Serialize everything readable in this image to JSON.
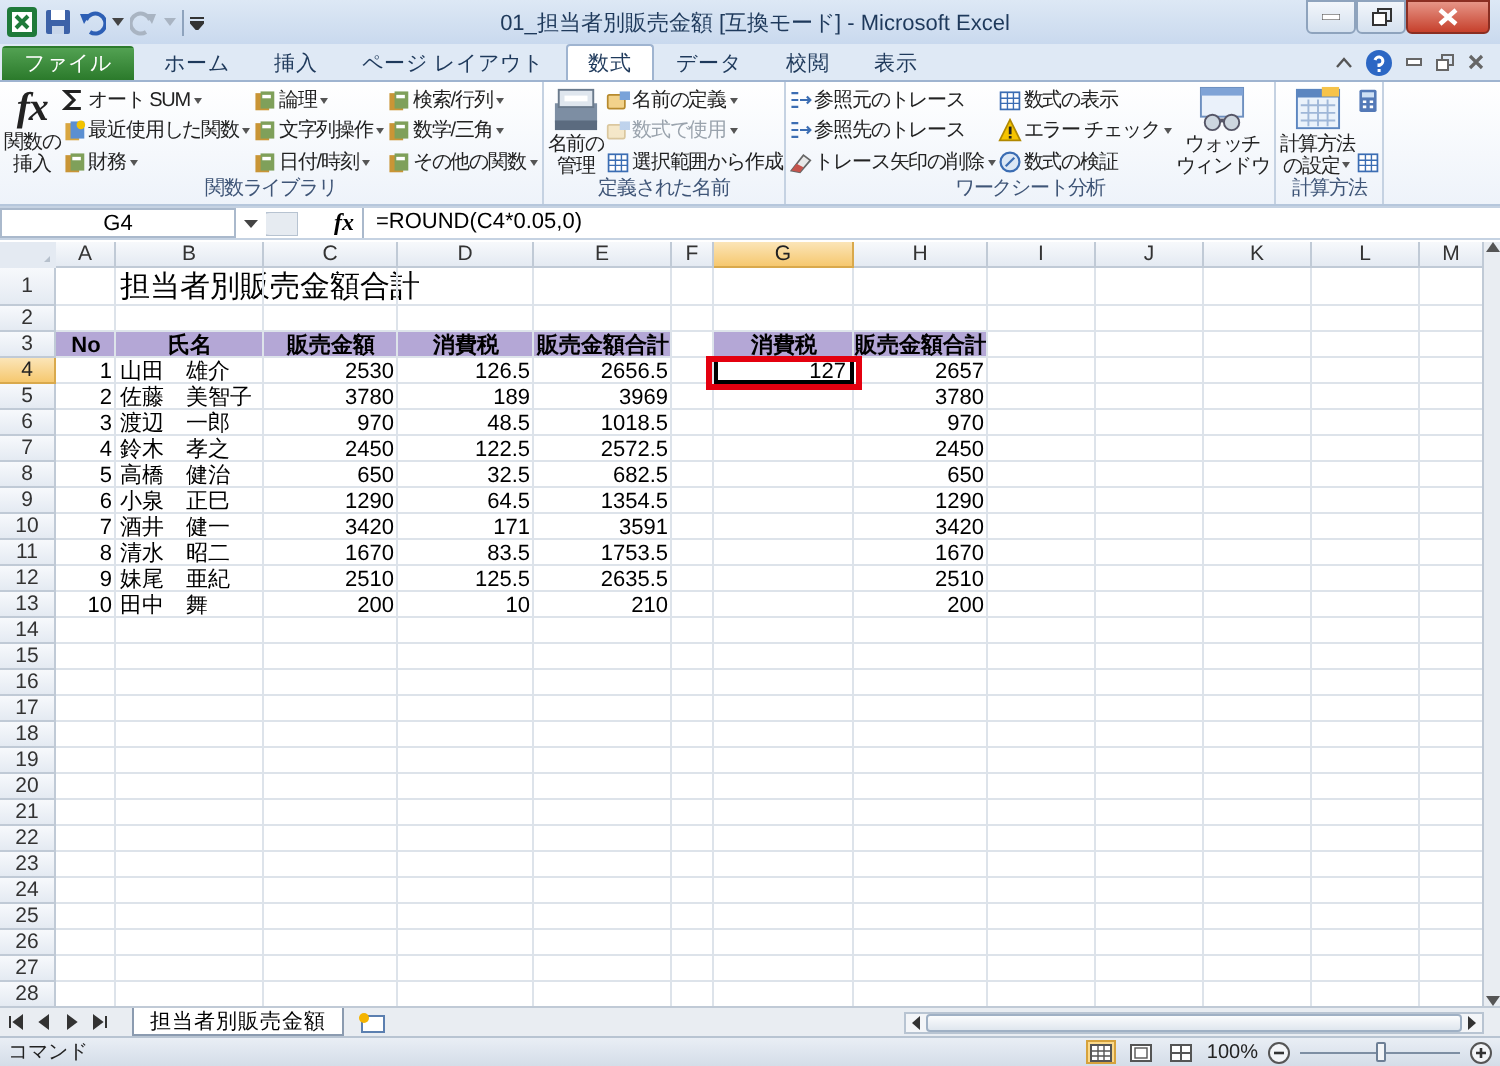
{
  "window": {
    "title": "01_担当者別販売金額 [互換モード] - Microsoft Excel",
    "quick_access": [
      {
        "kind": "save",
        "disabled": false
      },
      {
        "kind": "undo",
        "disabled": false
      },
      {
        "kind": "redo",
        "disabled": true
      }
    ]
  },
  "tabs": [
    {
      "label": "ファイル",
      "kind": "file",
      "selected": false
    },
    {
      "label": "ホーム",
      "kind": "tab",
      "selected": false
    },
    {
      "label": "挿入",
      "kind": "tab",
      "selected": false
    },
    {
      "label": "ページ レイアウト",
      "kind": "tab",
      "selected": false
    },
    {
      "label": "数式",
      "kind": "tab",
      "selected": true
    },
    {
      "label": "データ",
      "kind": "tab",
      "selected": false
    },
    {
      "label": "校閲",
      "kind": "tab",
      "selected": false
    },
    {
      "label": "表示",
      "kind": "tab",
      "selected": false
    }
  ],
  "ribbon": {
    "groups": [
      {
        "label": "関数ライブラリ",
        "large": [
          {
            "glyph": "fx",
            "lines": [
              "関数の",
              "挿入"
            ],
            "dropdown": false
          }
        ],
        "columns": [
          [
            {
              "label": "オート SUM",
              "dropdown": true,
              "disabled": false
            },
            {
              "label": "最近使用した関数",
              "dropdown": true,
              "disabled": false
            },
            {
              "label": "財務",
              "dropdown": true,
              "disabled": false
            }
          ],
          [
            {
              "label": "論理",
              "dropdown": true,
              "disabled": false
            },
            {
              "label": "文字列操作",
              "dropdown": true,
              "disabled": false
            },
            {
              "label": "日付/時刻",
              "dropdown": true,
              "disabled": false
            }
          ],
          [
            {
              "label": "検索/行列",
              "dropdown": true,
              "disabled": false
            },
            {
              "label": "数学/三角",
              "dropdown": true,
              "disabled": false
            },
            {
              "label": "その他の関数",
              "dropdown": true,
              "disabled": false
            }
          ]
        ]
      },
      {
        "label": "定義された名前",
        "large": [
          {
            "lines": [
              "名前の",
              "管理"
            ],
            "dropdown": false
          }
        ],
        "columns": [
          [
            {
              "label": "名前の定義",
              "dropdown": true,
              "disabled": false
            },
            {
              "label": "数式で使用",
              "dropdown": true,
              "disabled": true
            },
            {
              "label": "選択範囲から作成",
              "dropdown": false,
              "disabled": false
            }
          ]
        ]
      },
      {
        "label": "ワークシート分析",
        "columns": [
          [
            {
              "label": "参照元のトレース",
              "dropdown": false,
              "disabled": false
            },
            {
              "label": "参照先のトレース",
              "dropdown": false,
              "disabled": false
            },
            {
              "label": "トレース矢印の削除",
              "dropdown": true,
              "disabled": false
            }
          ],
          [
            {
              "label": "数式の表示",
              "dropdown": false,
              "disabled": false
            },
            {
              "label": "エラー チェック",
              "dropdown": true,
              "disabled": false
            },
            {
              "label": "数式の検証",
              "dropdown": false,
              "disabled": false
            }
          ]
        ],
        "large_after": [
          {
            "lines": [
              "ウォッチ",
              "ウィンドウ"
            ],
            "dropdown": false
          }
        ]
      },
      {
        "label": "計算方法",
        "large": [
          {
            "lines": [
              "計算方法",
              "の設定"
            ],
            "dropdown": true
          }
        ],
        "columns": [
          [
            {
              "dropdown": false,
              "disabled": false
            },
            {
              "dropdown": false,
              "disabled": false
            }
          ]
        ]
      }
    ]
  },
  "formula_bar": {
    "name_box": "G4",
    "fx": "fx",
    "formula": "=ROUND(C4*0.05,0)"
  },
  "sheet": {
    "columns": [
      {
        "label": "A",
        "selected": false
      },
      {
        "label": "B",
        "selected": false
      },
      {
        "label": "C",
        "selected": false
      },
      {
        "label": "D",
        "selected": false
      },
      {
        "label": "E",
        "selected": false
      },
      {
        "label": "F",
        "selected": false
      },
      {
        "label": "G",
        "selected": true
      },
      {
        "label": "H",
        "selected": false
      },
      {
        "label": "I",
        "selected": false
      },
      {
        "label": "J",
        "selected": false
      },
      {
        "label": "K",
        "selected": false
      },
      {
        "label": "L",
        "selected": false
      },
      {
        "label": "M",
        "selected": false
      }
    ],
    "rows": [
      {
        "number": "1",
        "kind": "title",
        "selected": false,
        "cells": {
          "B": "担当者別販売金額合計"
        }
      },
      {
        "number": "2",
        "kind": "data",
        "selected": false
      },
      {
        "number": "3",
        "kind": "header",
        "selected": false,
        "cells": {
          "A": "No",
          "B": "氏名",
          "C": "販売金額",
          "D": "消費税",
          "E": "販売金額合計",
          "G": "消費税",
          "H": "販売金額合計"
        }
      },
      {
        "number": "4",
        "kind": "data",
        "selected": true,
        "cells": {
          "A": "1",
          "B": "山田　雄介",
          "C": "2530",
          "D": "126.5",
          "E": "2656.5",
          "G": {
            "value": "127",
            "active": true,
            "framed": true
          },
          "H": "2657"
        }
      },
      {
        "number": "5",
        "kind": "data",
        "selected": false,
        "cells": {
          "A": "2",
          "B": "佐藤　美智子",
          "C": "3780",
          "D": "189",
          "E": "3969",
          "H": "3780"
        }
      },
      {
        "number": "6",
        "kind": "data",
        "selected": false,
        "cells": {
          "A": "3",
          "B": "渡辺　一郎",
          "C": "970",
          "D": "48.5",
          "E": "1018.5",
          "H": "970"
        }
      },
      {
        "number": "7",
        "kind": "data",
        "selected": false,
        "cells": {
          "A": "4",
          "B": "鈴木　孝之",
          "C": "2450",
          "D": "122.5",
          "E": "2572.5",
          "H": "2450"
        }
      },
      {
        "number": "8",
        "kind": "data",
        "selected": false,
        "cells": {
          "A": "5",
          "B": "高橋　健治",
          "C": "650",
          "D": "32.5",
          "E": "682.5",
          "H": "650"
        }
      },
      {
        "number": "9",
        "kind": "data",
        "selected": false,
        "cells": {
          "A": "6",
          "B": "小泉　正巳",
          "C": "1290",
          "D": "64.5",
          "E": "1354.5",
          "H": "1290"
        }
      },
      {
        "number": "10",
        "kind": "data",
        "selected": false,
        "cells": {
          "A": "7",
          "B": "酒井　健一",
          "C": "3420",
          "D": "171",
          "E": "3591",
          "H": "3420"
        }
      },
      {
        "number": "11",
        "kind": "data",
        "selected": false,
        "cells": {
          "A": "8",
          "B": "清水　昭二",
          "C": "1670",
          "D": "83.5",
          "E": "1753.5",
          "H": "1670"
        }
      },
      {
        "number": "12",
        "kind": "data",
        "selected": false,
        "cells": {
          "A": "9",
          "B": "妹尾　亜紀",
          "C": "2510",
          "D": "125.5",
          "E": "2635.5",
          "H": "2510"
        }
      },
      {
        "number": "13",
        "kind": "data",
        "selected": false,
        "cells": {
          "A": "10",
          "B": "田中　舞",
          "C": "200",
          "D": "10",
          "E": "210",
          "H": "200"
        }
      },
      {
        "number": "14",
        "kind": "data",
        "selected": false
      },
      {
        "number": "15",
        "kind": "data",
        "selected": false
      },
      {
        "number": "16",
        "kind": "data",
        "selected": false
      },
      {
        "number": "17",
        "kind": "data",
        "selected": false
      },
      {
        "number": "18",
        "kind": "data",
        "selected": false
      },
      {
        "number": "19",
        "kind": "data",
        "selected": false
      },
      {
        "number": "20",
        "kind": "data",
        "selected": false
      },
      {
        "number": "21",
        "kind": "data",
        "selected": false
      },
      {
        "number": "22",
        "kind": "data",
        "selected": false
      },
      {
        "number": "23",
        "kind": "data",
        "selected": false
      },
      {
        "number": "24",
        "kind": "data",
        "selected": false
      },
      {
        "number": "25",
        "kind": "data",
        "selected": false
      },
      {
        "number": "26",
        "kind": "data",
        "selected": false
      },
      {
        "number": "27",
        "kind": "data",
        "selected": false
      },
      {
        "number": "28",
        "kind": "data",
        "selected": false
      }
    ]
  },
  "sheet_tabs": [
    {
      "label": "担当者別販売金額",
      "selected": true
    }
  ],
  "status_bar": {
    "mode": "コマンド",
    "views": [
      {
        "kind": "normal",
        "selected": true
      },
      {
        "kind": "page-layout",
        "selected": false
      },
      {
        "kind": "page-break",
        "selected": false
      }
    ],
    "zoom": {
      "label": "100%",
      "level": 0.5
    }
  }
}
